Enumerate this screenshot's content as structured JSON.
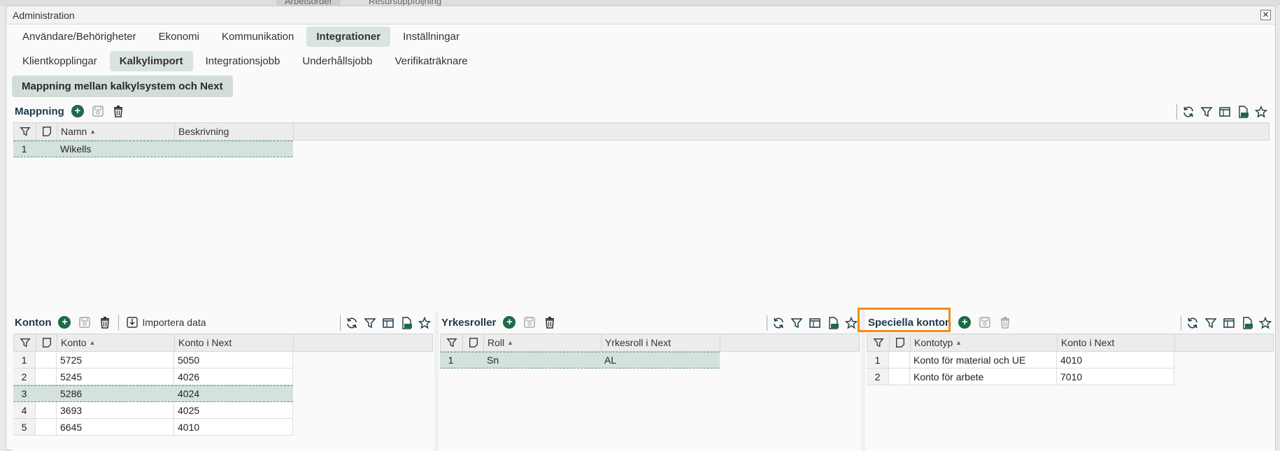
{
  "background": {
    "tabs": [
      "Arbetsorder",
      "Resursuppföljning"
    ]
  },
  "window": {
    "title": "Administration",
    "close_symbol": "✕"
  },
  "tabs_level1": [
    {
      "label": "Användare/Behörigheter",
      "active": false
    },
    {
      "label": "Ekonomi",
      "active": false
    },
    {
      "label": "Kommunikation",
      "active": false
    },
    {
      "label": "Integrationer",
      "active": true
    },
    {
      "label": "Inställningar",
      "active": false
    }
  ],
  "tabs_level2": [
    {
      "label": "Klientkopplingar",
      "active": false
    },
    {
      "label": "Kalkylimport",
      "active": true
    },
    {
      "label": "Integrationsjobb",
      "active": false
    },
    {
      "label": "Underhållsjobb",
      "active": false
    },
    {
      "label": "Verifikaträknare",
      "active": false
    }
  ],
  "tabs_level3": [
    {
      "label": "Mappning mellan kalkylsystem och Next",
      "active": true
    }
  ],
  "mappning": {
    "title": "Mappning",
    "columns": [
      "Namn",
      "Beskrivning"
    ],
    "rows": [
      {
        "num": "1",
        "namn": "Wikells",
        "beskrivning": ""
      }
    ]
  },
  "konton": {
    "title": "Konton",
    "import_label": "Importera data",
    "columns": [
      "Konto",
      "Konto i Next"
    ],
    "rows": [
      {
        "num": "1",
        "konto": "5725",
        "next": "5050"
      },
      {
        "num": "2",
        "konto": "5245",
        "next": "4026"
      },
      {
        "num": "3",
        "konto": "5286",
        "next": "4024"
      },
      {
        "num": "4",
        "konto": "3693",
        "next": "4025"
      },
      {
        "num": "5",
        "konto": "6645",
        "next": "4010"
      }
    ]
  },
  "yrkesroller": {
    "title": "Yrkesroller",
    "columns": [
      "Roll",
      "Yrkesroll i Next"
    ],
    "rows": [
      {
        "num": "1",
        "roll": "Sn",
        "next": "AL"
      }
    ]
  },
  "speciella": {
    "title": "Speciella konton",
    "columns": [
      "Kontotyp",
      "Konto i Next"
    ],
    "rows": [
      {
        "num": "1",
        "typ": "Konto för material och UE",
        "next": "4010"
      },
      {
        "num": "2",
        "typ": "Konto för arbete",
        "next": "7010"
      }
    ]
  },
  "colors": {
    "accent": "#1d6a46",
    "highlight": "#f08c1a",
    "selected_row": "#d3e3dc"
  }
}
